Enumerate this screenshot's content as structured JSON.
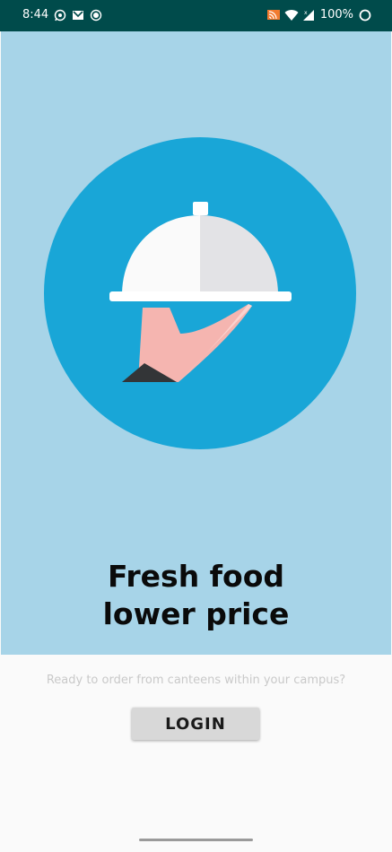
{
  "status_bar": {
    "time": "8:44",
    "left_icons": [
      "whatsapp-icon",
      "gmail-icon",
      "record-icon"
    ],
    "right_icons": [
      "cast-icon",
      "wifi-icon",
      "signal-icon",
      "battery-icon"
    ],
    "battery": "100%"
  },
  "hero": {
    "illustration": "cloche-serving-hand",
    "headline_line1": "Fresh food",
    "headline_line2": "lower price"
  },
  "footer": {
    "subtitle": "Ready to order from canteens within your campus?",
    "login_label": "LOGIN"
  },
  "colors": {
    "status_bar": "#004b4b",
    "hero_bg": "#a7d4e8",
    "circle": "#19a6d7",
    "page_bg": "#fafafa"
  }
}
